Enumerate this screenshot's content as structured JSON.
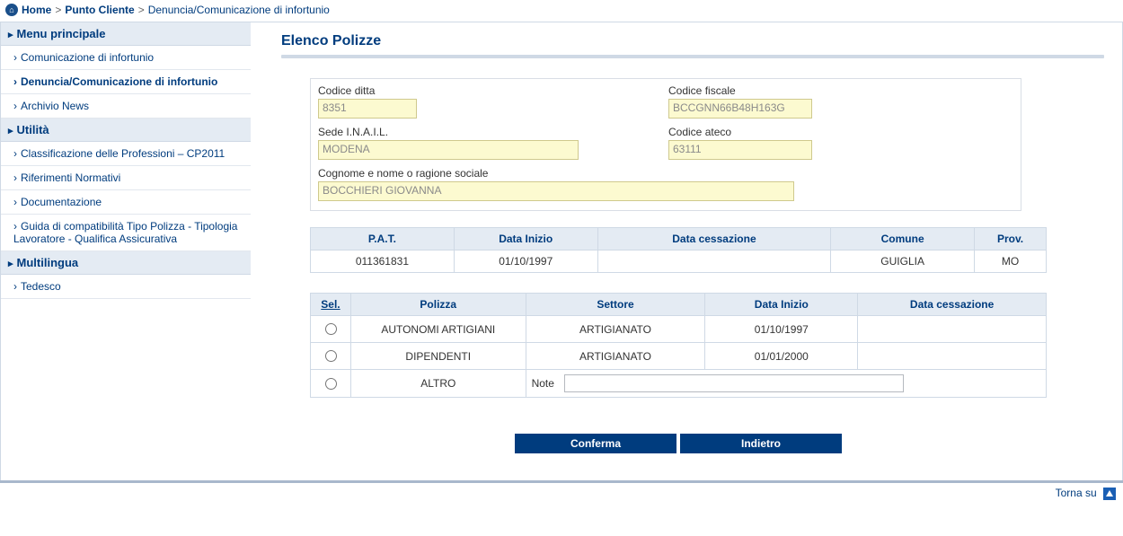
{
  "breadcrumb": {
    "home": "Home",
    "level1": "Punto Cliente",
    "level2": "Denuncia/Comunicazione di infortunio"
  },
  "sidebar": {
    "sections": [
      {
        "title": "Menu principale",
        "items": [
          {
            "label": "Comunicazione di infortunio",
            "active": false
          },
          {
            "label": "Denuncia/Comunicazione di infortunio",
            "active": true
          },
          {
            "label": "Archivio News",
            "active": false
          }
        ]
      },
      {
        "title": "Utilità",
        "items": [
          {
            "label": "Classificazione delle Professioni – CP2011",
            "active": false
          },
          {
            "label": "Riferimenti Normativi",
            "active": false
          },
          {
            "label": "Documentazione",
            "active": false
          },
          {
            "label": "Guida di compatibilità Tipo Polizza - Tipologia Lavoratore - Qualifica Assicurativa",
            "active": false
          }
        ]
      },
      {
        "title": "Multilingua",
        "items": [
          {
            "label": "Tedesco",
            "active": false
          }
        ]
      }
    ]
  },
  "page": {
    "title": "Elenco Polizze"
  },
  "company": {
    "codice_ditta_label": "Codice ditta",
    "codice_ditta": "8351",
    "codice_fiscale_label": "Codice fiscale",
    "codice_fiscale": "BCCGNN66B48H163G",
    "sede_label": "Sede I.N.A.I.L.",
    "sede": "MODENA",
    "codice_ateco_label": "Codice ateco",
    "codice_ateco": "63111",
    "ragione_label": "Cognome e nome o ragione sociale",
    "ragione": "BOCCHIERI GIOVANNA"
  },
  "pat_table": {
    "headers": {
      "pat": "P.A.T.",
      "data_inizio": "Data Inizio",
      "data_cessazione": "Data cessazione",
      "comune": "Comune",
      "prov": "Prov."
    },
    "row": {
      "pat": "011361831",
      "data_inizio": "01/10/1997",
      "data_cessazione": "",
      "comune": "GUIGLIA",
      "prov": "MO"
    }
  },
  "polizze_table": {
    "headers": {
      "sel": "Sel.",
      "polizza": "Polizza",
      "settore": "Settore",
      "data_inizio": "Data Inizio",
      "data_cessazione": "Data cessazione"
    },
    "rows": [
      {
        "polizza": "AUTONOMI ARTIGIANI",
        "settore": "ARTIGIANATO",
        "data_inizio": "01/10/1997",
        "data_cessazione": ""
      },
      {
        "polizza": "DIPENDENTI",
        "settore": "ARTIGIANATO",
        "data_inizio": "01/01/2000",
        "data_cessazione": ""
      },
      {
        "polizza": "ALTRO",
        "settore": "",
        "data_inizio": "",
        "data_cessazione": ""
      }
    ],
    "note_label": "Note",
    "note_value": ""
  },
  "buttons": {
    "confirm": "Conferma",
    "back": "Indietro"
  },
  "footer": {
    "top": "Torna su"
  }
}
